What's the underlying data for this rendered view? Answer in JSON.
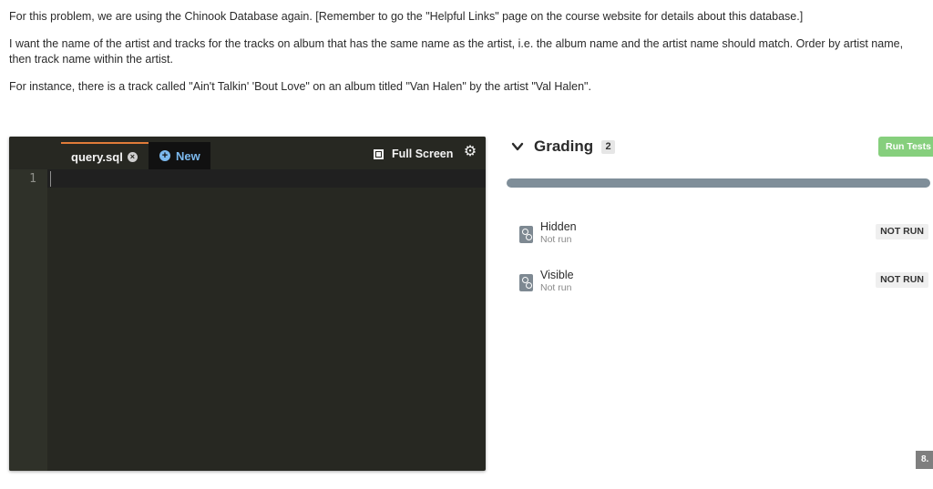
{
  "prompt": {
    "paragraphs": [
      "For this problem, we are using the Chinook Database again. [Remember to go the \"Helpful Links\" page on the course website for details about this database.]",
      "I want the name of the artist and tracks for the tracks on album that has the same name as the artist, i.e. the album name and the artist name should match. Order by artist name, then track name within the artist.",
      "For instance, there is a track called \"Ain't Talkin' 'Bout Love\" on an album titled \"Van Halen\" by the artist \"Val Halen\"."
    ]
  },
  "editor": {
    "tabs": [
      {
        "label": "query.sql",
        "icon": "close-circle-icon"
      },
      {
        "label": "New",
        "icon": "plus-circle-icon"
      }
    ],
    "fullscreen_label": "Full Screen",
    "line_numbers": [
      "1"
    ],
    "content": ""
  },
  "grading": {
    "title": "Grading",
    "count": "2",
    "run_button_label": "Run Tests",
    "progress": 0,
    "tests": [
      {
        "name": "Hidden",
        "status": "Not run",
        "badge": "NOT RUN"
      },
      {
        "name": "Visible",
        "status": "Not run",
        "badge": "NOT RUN"
      }
    ]
  },
  "corner_badge": "8.",
  "colors": {
    "editor_bg": "#272822",
    "tab_accent": "#e07b39",
    "new_tab_text": "#7cb9ee",
    "run_button": "#86cf7d",
    "progress_track": "#7f8e99"
  }
}
